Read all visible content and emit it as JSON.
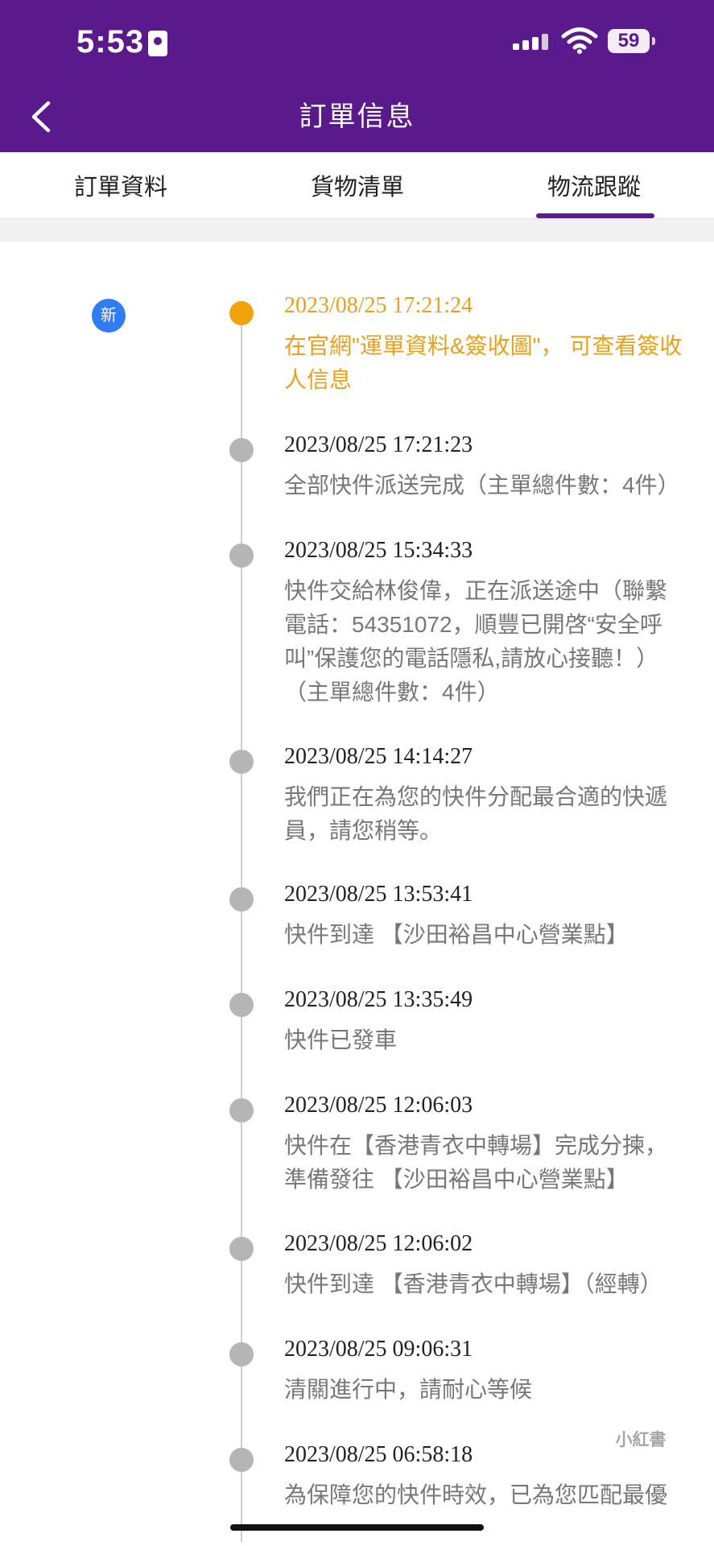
{
  "status_bar": {
    "time": "5:53",
    "battery": "59"
  },
  "header": {
    "title": "訂單信息"
  },
  "tabs": [
    {
      "label": "訂單資料"
    },
    {
      "label": "貨物清單"
    },
    {
      "label": "物流跟蹤"
    }
  ],
  "timeline": {
    "new_badge": "新",
    "events": [
      {
        "time": "2023/08/25 17:21:24",
        "description": "在官網\"運單資料&簽收圖\"， 可查看簽收人信息"
      },
      {
        "time": "2023/08/25 17:21:23",
        "description": "全部快件派送完成（主單總件數：4件）"
      },
      {
        "time": "2023/08/25 15:34:33",
        "description": "快件交給林俊偉，正在派送途中（聯繫電話：54351072，順豐已開啓“安全呼叫”保護您的電話隱私,請放心接聽！）（主單總件數：4件）"
      },
      {
        "time": "2023/08/25 14:14:27",
        "description": "我們正在為您的快件分配最合適的快遞員，請您稍等。"
      },
      {
        "time": "2023/08/25 13:53:41",
        "description": "快件到達 【沙田裕昌中心營業點】"
      },
      {
        "time": "2023/08/25 13:35:49",
        "description": "快件已發車"
      },
      {
        "time": "2023/08/25 12:06:03",
        "description": "快件在【香港青衣中轉場】完成分揀，準備發往 【沙田裕昌中心營業點】"
      },
      {
        "time": "2023/08/25 12:06:02",
        "description": "快件到達 【香港青衣中轉場】（經轉）"
      },
      {
        "time": "2023/08/25 09:06:31",
        "description": "清關進行中，請耐心等候"
      },
      {
        "time": "2023/08/25 06:58:18",
        "description": "為保障您的快件時效，已為您匹配最優"
      }
    ]
  },
  "watermark": "小紅書"
}
